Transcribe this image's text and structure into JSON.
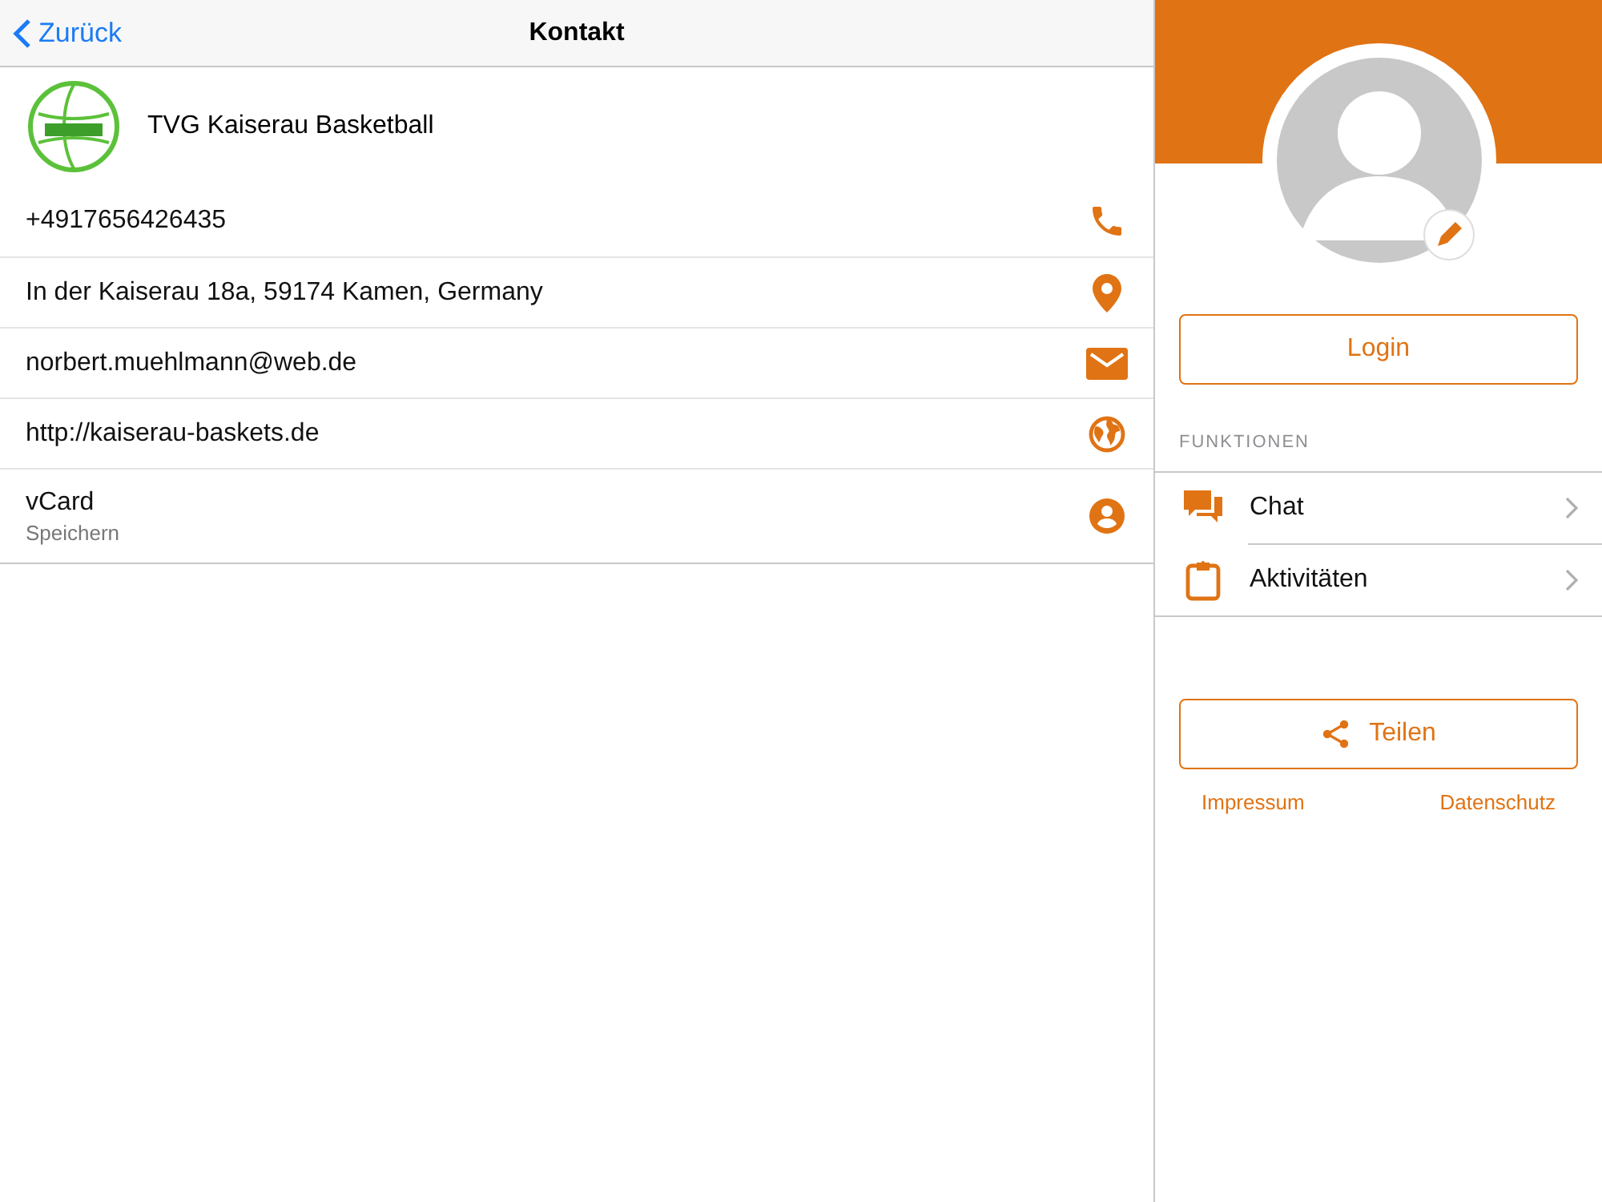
{
  "nav_bar": {
    "back": "Zurück",
    "title": "Kontakt"
  },
  "organization": {
    "name": "TVG Kaiserau Basketball"
  },
  "contact_rows": [
    {
      "kind": "phone",
      "text": "+4917656426435"
    },
    {
      "kind": "location",
      "text": "In der Kaiserau 18a, 59174 Kamen, Germany"
    },
    {
      "kind": "email",
      "text": "norbert.muehlmann@web.de"
    },
    {
      "kind": "web",
      "text": "http://kaiserau-baskets.de"
    },
    {
      "kind": "vcard",
      "text": "vCard",
      "subtitle": "Speichern"
    }
  ],
  "side_panel": {
    "login_button": "Login",
    "section_header": "FUNKTIONEN",
    "menu": [
      {
        "kind": "chat",
        "label": "Chat"
      },
      {
        "kind": "activities",
        "label": "Aktivitäten"
      }
    ],
    "share_button": "Teilen",
    "links": [
      "Impressum",
      "Datenschutz"
    ]
  }
}
